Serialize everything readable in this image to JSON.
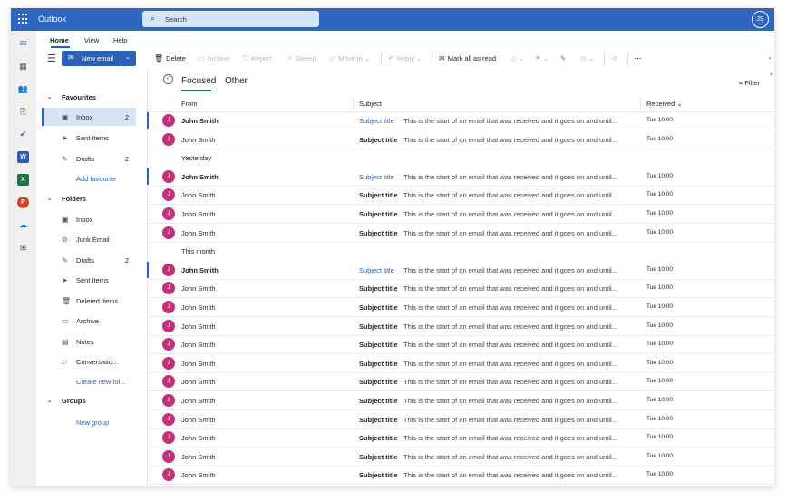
{
  "app": {
    "title": "Outlook",
    "user_initials": "JS"
  },
  "search": {
    "placeholder": "Search"
  },
  "ribbon": {
    "tabs": [
      "Home",
      "View",
      "Help"
    ]
  },
  "toolbar": {
    "new_mail": "New email",
    "delete": "Delete",
    "archive": "Archive",
    "report": "Report",
    "sweep": "Sweep",
    "move_to": "Move to",
    "reply": "Reply",
    "mark_all_read": "Mark all as read",
    "more": "···"
  },
  "folders": {
    "favourites_label": "Favourites",
    "favourites": [
      {
        "label": "Inbox",
        "count": "2",
        "icon": "inbox-icon"
      },
      {
        "label": "Sent Items",
        "count": "",
        "icon": "send-icon"
      },
      {
        "label": "Drafts",
        "count": "2",
        "icon": "pencil-icon"
      }
    ],
    "add_favourite": "Add favourite",
    "folders_label": "Folders",
    "items": [
      {
        "label": "Inbox",
        "count": "",
        "icon": "inbox-icon"
      },
      {
        "label": "Junk Email",
        "count": "",
        "icon": "junk-icon"
      },
      {
        "label": "Drafts",
        "count": "2",
        "icon": "pencil-icon"
      },
      {
        "label": "Sent Items",
        "count": "",
        "icon": "send-icon"
      },
      {
        "label": "Deleted Items",
        "count": "",
        "icon": "trash-icon"
      },
      {
        "label": "Archive",
        "count": "",
        "icon": "archive-icon"
      },
      {
        "label": "Notes",
        "count": "",
        "icon": "note-icon"
      },
      {
        "label": "Conversatio...",
        "count": "",
        "icon": "folder-icon"
      }
    ],
    "create_folder": "Create new fol...",
    "groups_label": "Groups",
    "new_group": "New group"
  },
  "list": {
    "tabs": [
      "Focused",
      "Other"
    ],
    "filter": "Filter",
    "columns": {
      "from": "From",
      "subject": "Subject",
      "received": "Received"
    },
    "groups": [
      "Yesterday",
      "This month"
    ],
    "sender": "John Smith",
    "avatar": "J",
    "subject": "Subject title",
    "preview": "This is the start of an email that was received and it goes on and until...",
    "received": "Tue 10:00"
  },
  "colors": {
    "brand": "#2f67c0",
    "accent": "#2b62b8",
    "avatar": "#c4307a"
  }
}
